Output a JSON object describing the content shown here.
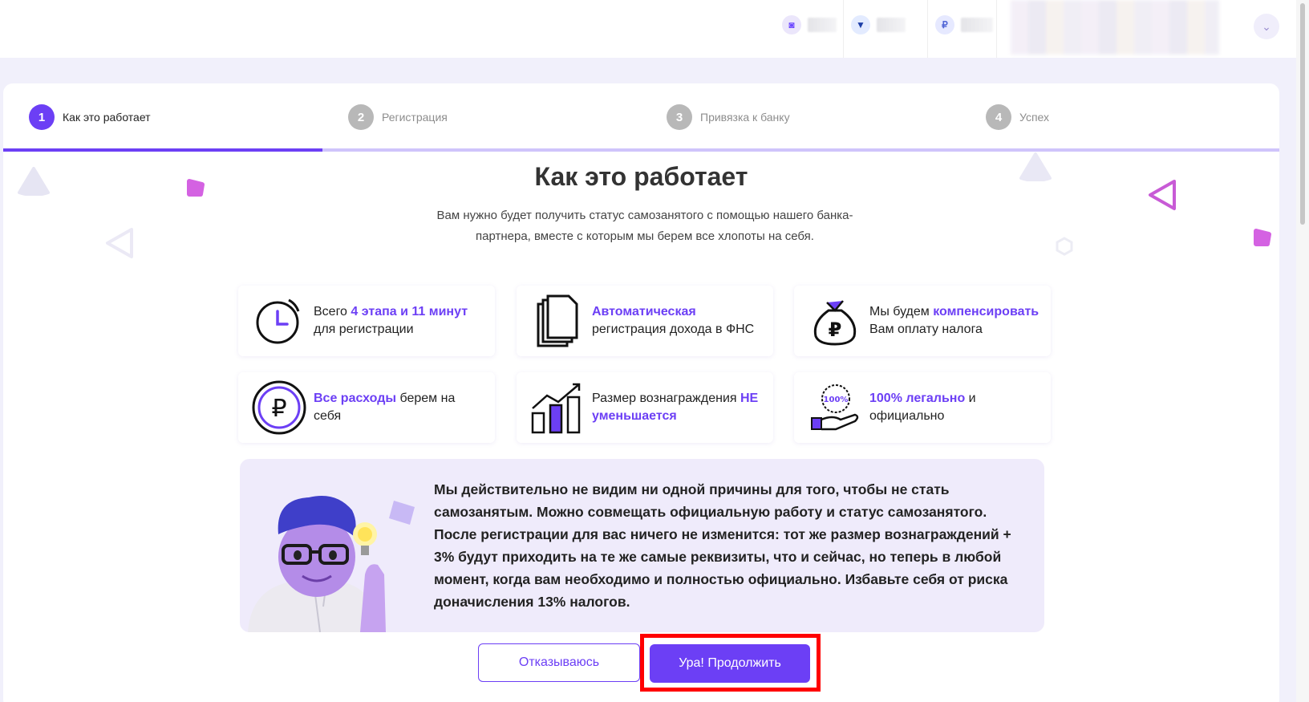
{
  "header": {
    "items": [
      {
        "icon": "wallet-icon",
        "glyph": "◙"
      },
      {
        "icon": "shield-icon",
        "glyph": "▼"
      },
      {
        "icon": "ruble-icon",
        "glyph": "₽"
      }
    ],
    "dropdown_glyph": "⌄"
  },
  "steps": [
    {
      "num": "1",
      "label": "Как это работает",
      "active": true
    },
    {
      "num": "2",
      "label": "Регистрация",
      "active": false
    },
    {
      "num": "3",
      "label": "Привязка к банку",
      "active": false
    },
    {
      "num": "4",
      "label": "Успех",
      "active": false
    }
  ],
  "progress": 0.25,
  "main": {
    "title": "Как это работает",
    "subtitle": "Вам нужно будет получить статус самозанятого с помощью нашего банка-партнера, вместе с которым мы берем все хлопоты на себя."
  },
  "features": [
    {
      "icon": "clock-icon",
      "pre": "Всего ",
      "hl": "4 этапа и 11 минут",
      "post": " для регистрации"
    },
    {
      "icon": "documents-icon",
      "pre": "",
      "hl": "Автоматическая",
      "post": " регистрация дохода в ФНС"
    },
    {
      "icon": "money-bag-icon",
      "pre": "Мы будем ",
      "hl": "компенсировать",
      "post": " Вам оплату налога"
    },
    {
      "icon": "ruble-coin-icon",
      "pre": "",
      "hl": "Все расходы",
      "post": " берем на себя"
    },
    {
      "icon": "growth-chart-icon",
      "pre": "Размер вознаграждения ",
      "hl": "НЕ уменьшается",
      "post": ""
    },
    {
      "icon": "hand-100-percent-icon",
      "pre": "",
      "hl": "100% легально",
      "post": " и официально"
    }
  ],
  "info": {
    "text": "Мы действительно не видим ни одной причины для того, чтобы не стать самозанятым. Можно совмещать официальную работу и статус самозанятого. После регистрации для вас ничего не изменится: тот же размер вознаграждений + 3% будут приходить на те же самые реквизиты, что и сейчас, но теперь в любой момент, когда вам необходимо и полностью официально. Избавьте себя от риска доначисления 13% налогов."
  },
  "buttons": {
    "decline": "Отказываюсь",
    "continue": "Ура! Продолжить"
  },
  "colors": {
    "accent": "#6c3ff5",
    "accent_light": "#cfc4fb",
    "info_bg": "#efebfb",
    "highlight": "#ff0000"
  }
}
